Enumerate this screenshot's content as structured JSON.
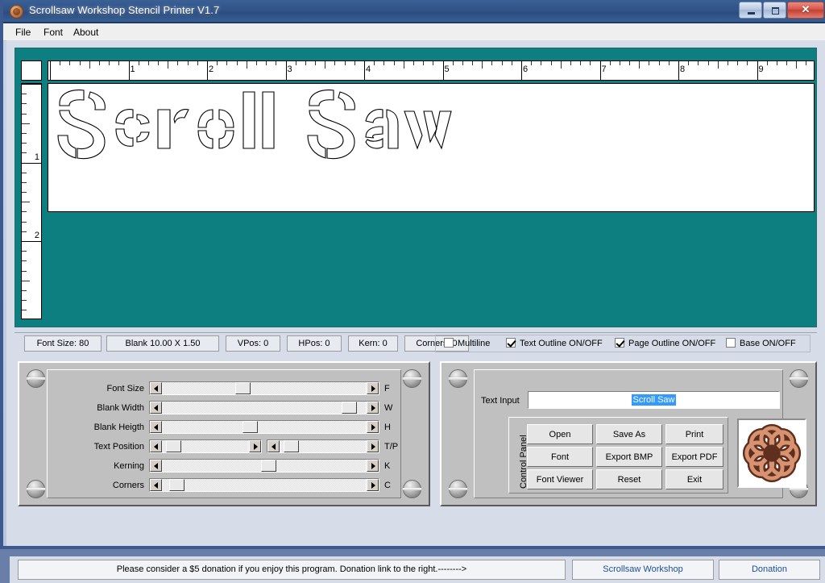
{
  "window": {
    "title": "Scrollsaw Workshop Stencil Printer V1.7",
    "icon": "celtic-knot-icon",
    "controls": {
      "minimize": "–",
      "maximize": "□",
      "close": "✕"
    }
  },
  "menu": {
    "items": [
      "File",
      "Font",
      "About"
    ]
  },
  "canvas": {
    "background_color": "#0d7f80",
    "page_color": "#ffffff",
    "stencil_text": "Scroll Saw",
    "hruler_numbers": [
      "1",
      "2",
      "3",
      "4",
      "5",
      "6",
      "7",
      "8",
      "9"
    ],
    "vruler_numbers": [
      "1",
      "2"
    ]
  },
  "status": {
    "fields": [
      {
        "label": "Font Size: 80"
      },
      {
        "label": "Blank 10.00 X 1.50"
      },
      {
        "label": "VPos: 0"
      },
      {
        "label": "HPos: 0"
      },
      {
        "label": "Kern: 0"
      },
      {
        "label": "Corners: 0"
      }
    ],
    "checkboxes": [
      {
        "label": "Multiline",
        "checked": false
      },
      {
        "label": "Text Outline ON/OFF",
        "checked": true
      },
      {
        "label": "Page Outline ON/OFF",
        "checked": true
      },
      {
        "label": "Base ON/OFF",
        "checked": false
      }
    ]
  },
  "sliders": [
    {
      "label": "Font Size",
      "letter": "F",
      "value_pct": 38,
      "dual": false
    },
    {
      "label": "Blank Width",
      "letter": "W",
      "value_pct": 95,
      "dual": false
    },
    {
      "label": "Blank Heigth",
      "letter": "H",
      "value_pct": 42,
      "dual": false
    },
    {
      "label": "Text Position",
      "letter": "T/P",
      "value_pct": 4,
      "value_pct2": 4,
      "dual": true
    },
    {
      "label": "Kerning",
      "letter": "K",
      "value_pct": 52,
      "dual": false
    },
    {
      "label": "Corners",
      "letter": "C",
      "value_pct": 3,
      "dual": false
    }
  ],
  "control_panel": {
    "text_input_label": "Text Input",
    "text_input_value": "Scroll Saw",
    "group_label": "Control Panel",
    "buttons": [
      "Open",
      "Save As",
      "Print",
      "Font",
      "Export BMP",
      "Export PDF",
      "Font Viewer",
      "Reset",
      "Exit"
    ],
    "logo": "celtic-knot-logo"
  },
  "footer": {
    "message": "Please consider a $5 donation if you enjoy this program. Donation link to the right.-------->",
    "link1": "Scrollsaw Workshop",
    "link2": "Donation"
  }
}
